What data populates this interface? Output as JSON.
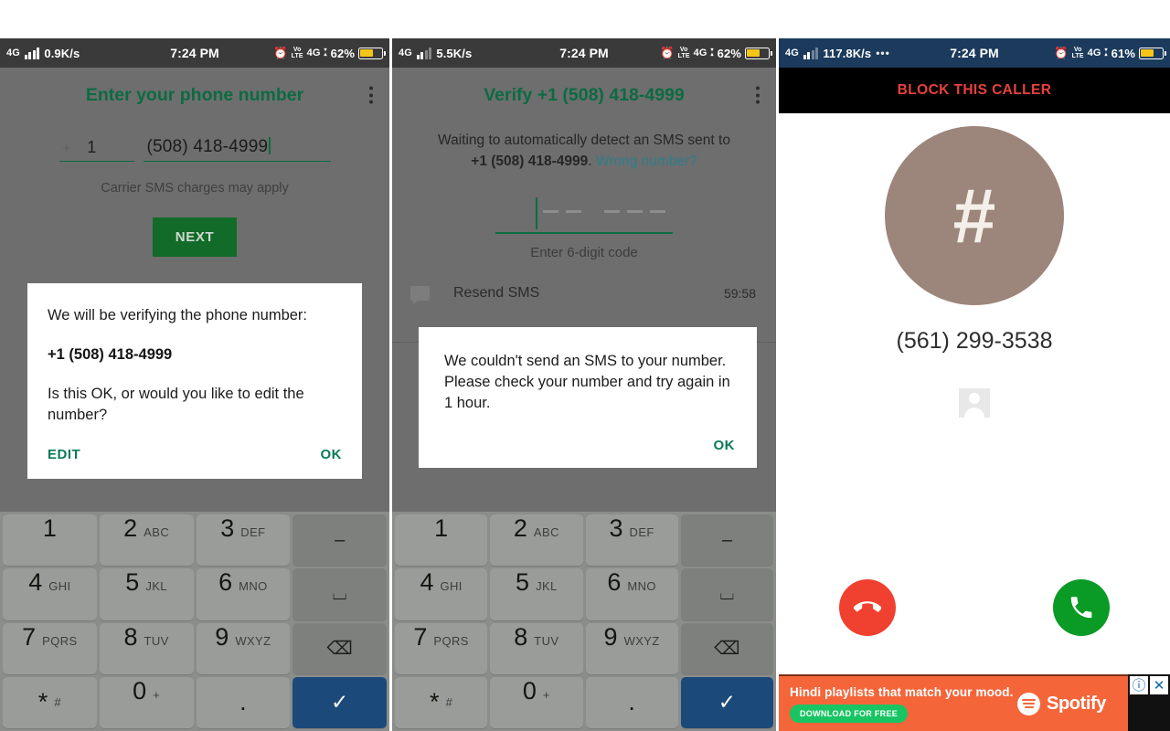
{
  "panels": [
    {
      "id": "enter-phone-number",
      "status_bar": {
        "network": "4G",
        "speed": "0.9K/s",
        "time": "7:24 PM",
        "volte": "VoLTE",
        "network_right": "4G",
        "battery_pct": "62%",
        "battery_level": 62,
        "theme_color": "#3a3a3a"
      },
      "app_bar": {
        "title": "Enter your phone number",
        "menu": "overflow-menu"
      },
      "form": {
        "plus": "+",
        "country_code": "1",
        "phone_number": "(508) 418-4999",
        "carrier_note": "Carrier SMS charges may apply",
        "next_label": "NEXT"
      },
      "dialog": {
        "line1": "We will be verifying the phone number:",
        "number": "+1 (508) 418-4999",
        "line2": "Is this OK, or would you like to edit the number?",
        "edit_label": "EDIT",
        "ok_label": "OK"
      }
    },
    {
      "id": "verify-code",
      "status_bar": {
        "network": "4G",
        "speed": "5.5K/s",
        "time": "7:24 PM",
        "volte": "VoLTE",
        "network_right": "4G",
        "battery_pct": "62%",
        "battery_level": 62,
        "theme_color": "#3a3a3a"
      },
      "app_bar": {
        "title": "Verify +1 (508) 418-4999",
        "menu": "overflow-menu"
      },
      "verify": {
        "waiting_text": "Waiting to automatically detect an SMS sent to",
        "number": "+1 (508) 418-4999",
        "punct": ".",
        "wrong_number_link": "Wrong number?",
        "code_hint": "Enter 6-digit code",
        "resend_label": "Resend SMS",
        "resend_timer": "59:58"
      },
      "dialog": {
        "message": "We couldn't send an SMS to your number. Please check your number and try again in 1 hour.",
        "ok_label": "OK"
      }
    },
    {
      "id": "incoming-call",
      "status_bar": {
        "network": "4G",
        "speed": "117.8K/s",
        "speed_suffix": "•••",
        "time": "7:24 PM",
        "volte": "VoLTE",
        "network_right": "4G",
        "battery_pct": "61%",
        "battery_level": 61,
        "theme_color": "#1b3a5c"
      },
      "call": {
        "block_label": "BLOCK THIS CALLER",
        "block_color": "#e8413c",
        "avatar_glyph": "#",
        "avatar_color": "#9c857a",
        "number": "(561) 299-3538",
        "decline_color": "#f0402f",
        "accept_color": "#0a9a26"
      },
      "ad": {
        "headline": "Hindi playlists that match your mood.",
        "cta": "DOWNLOAD FOR FREE",
        "brand": "Spotify",
        "info_glyph": "ⓘ",
        "close_glyph": "✕",
        "bg_color": "#f4663a"
      }
    }
  ],
  "keyboard": {
    "rows": [
      [
        {
          "big": "1",
          "sml": ""
        },
        {
          "big": "2",
          "sml": "ABC"
        },
        {
          "big": "3",
          "sml": "DEF"
        },
        {
          "fn": "dash",
          "glyph": "–"
        }
      ],
      [
        {
          "big": "4",
          "sml": "GHI"
        },
        {
          "big": "5",
          "sml": "JKL"
        },
        {
          "big": "6",
          "sml": "MNO"
        },
        {
          "fn": "space",
          "glyph": "⌴"
        }
      ],
      [
        {
          "big": "7",
          "sml": "PQRS"
        },
        {
          "big": "8",
          "sml": "TUV"
        },
        {
          "big": "9",
          "sml": "WXYZ"
        },
        {
          "fn": "backspace",
          "glyph": "⌫"
        }
      ],
      [
        {
          "big": "*",
          "sml": "#",
          "center": true
        },
        {
          "big": "0",
          "sml": "+"
        },
        {
          "big": ".",
          "sml": "",
          "center": true
        },
        {
          "fn": "enter",
          "glyph": "✓"
        }
      ]
    ]
  }
}
